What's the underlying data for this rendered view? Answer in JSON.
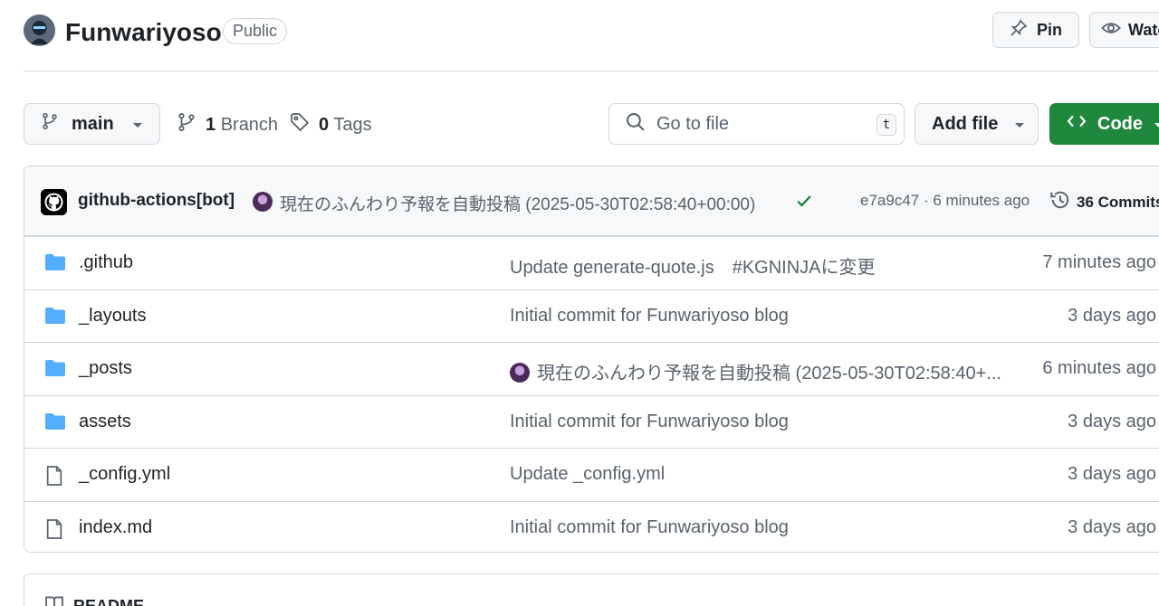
{
  "repo": {
    "name": "Funwariyoso",
    "visibility": "Public",
    "pin_label": "Pin",
    "watch_label": "Watch"
  },
  "toolbar": {
    "branch": "main",
    "branches_count": "1",
    "branches_label": "Branch",
    "tags_count": "0",
    "tags_label": "Tags",
    "search_placeholder": "Go to file",
    "search_shortcut": "t",
    "add_file_label": "Add file",
    "code_label": "Code"
  },
  "latest_commit": {
    "author": "github-actions[bot]",
    "message": "現在のふんわり予報を自動投稿 (2025-05-30T02:58:40+00:00)",
    "meta": "e7a9c47 · 6 minutes ago",
    "commits_label": "36 Commits",
    "status": "success"
  },
  "files": [
    {
      "type": "folder",
      "name": ".github",
      "message": "Update generate-quote.js　#KGNINJAに変更",
      "time": "7 minutes ago",
      "avatar": false
    },
    {
      "type": "folder",
      "name": "_layouts",
      "message": "Initial commit for Funwariyoso blog",
      "time": "3 days ago",
      "avatar": false
    },
    {
      "type": "folder",
      "name": "_posts",
      "message": "現在のふんわり予報を自動投稿 (2025-05-30T02:58:40+...",
      "time": "6 minutes ago",
      "avatar": true
    },
    {
      "type": "folder",
      "name": "assets",
      "message": "Initial commit for Funwariyoso blog",
      "time": "3 days ago",
      "avatar": false
    },
    {
      "type": "file",
      "name": "_config.yml",
      "message": "Update _config.yml",
      "time": "3 days ago",
      "avatar": false
    },
    {
      "type": "file",
      "name": "index.md",
      "message": "Initial commit for Funwariyoso blog",
      "time": "3 days ago",
      "avatar": false
    }
  ],
  "readme": {
    "label": "README"
  },
  "colors": {
    "folder": "#54aeff",
    "code_button": "#1f883d",
    "success": "#1a7f37"
  }
}
